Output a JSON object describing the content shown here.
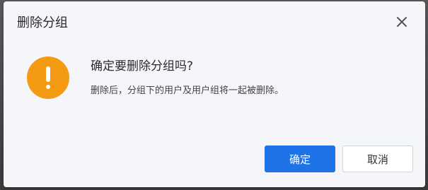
{
  "dialog": {
    "title": "删除分组",
    "question": "确定要删除分组吗?",
    "detail": "删除后，分组下的用户及用户组将一起被删除。",
    "icon": "warning-icon",
    "confirm_label": "确定",
    "cancel_label": "取消"
  },
  "colors": {
    "warning": "#f39a12",
    "primary": "#1e73e8",
    "dialog_bg": "#f5f6f9"
  }
}
